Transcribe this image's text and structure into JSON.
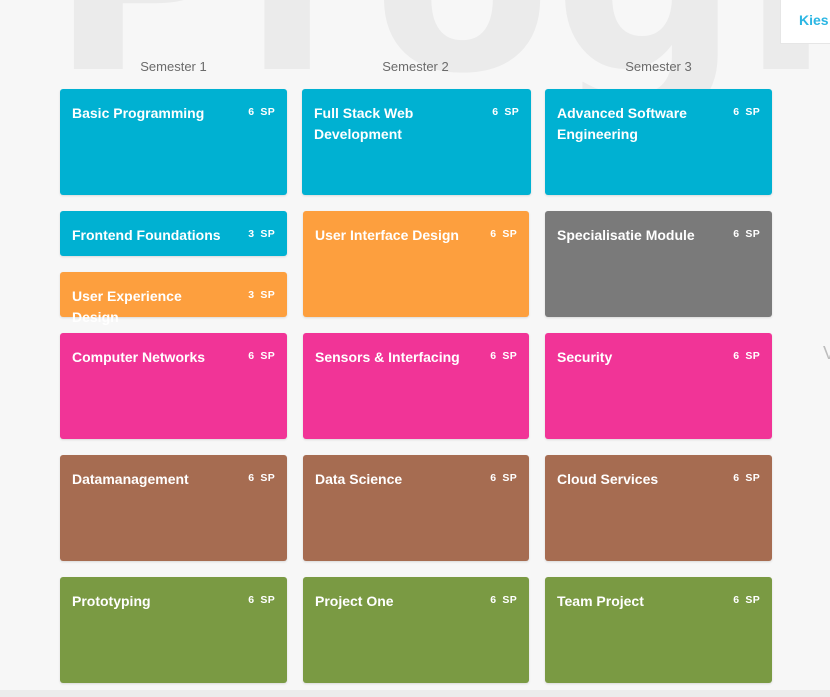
{
  "background_watermark": "Progra",
  "top_tab_label": "Kies",
  "edge_letter": "V",
  "semesters": [
    {
      "label": "Semester 1"
    },
    {
      "label": "Semester 2"
    },
    {
      "label": "Semester 3"
    }
  ],
  "credit_unit": "SP",
  "colors": {
    "blue": "#00b1d2",
    "orange": "#fd9f3e",
    "gray": "#7a7a7a",
    "pink": "#f13497",
    "brown": "#a66c51",
    "green": "#7a9a43"
  },
  "modules": [
    {
      "title": "Basic Programming",
      "credits": "6",
      "color": "blue"
    },
    {
      "title": "Full Stack Web Development",
      "credits": "6",
      "color": "blue"
    },
    {
      "title": "Advanced Software Engineering",
      "credits": "6",
      "color": "blue"
    },
    {
      "title": "Frontend Foundations",
      "credits": "3",
      "color": "blue"
    },
    {
      "title": "User Experience Design",
      "credits": "3",
      "color": "orange"
    },
    {
      "title": "User Interface Design",
      "credits": "6",
      "color": "orange"
    },
    {
      "title": "Specialisatie Module",
      "credits": "6",
      "color": "gray"
    },
    {
      "title": "Computer Networks",
      "credits": "6",
      "color": "pink"
    },
    {
      "title": "Sensors & Interfacing",
      "credits": "6",
      "color": "pink"
    },
    {
      "title": "Security",
      "credits": "6",
      "color": "pink"
    },
    {
      "title": "Datamanagement",
      "credits": "6",
      "color": "brown"
    },
    {
      "title": "Data Science",
      "credits": "6",
      "color": "brown"
    },
    {
      "title": "Cloud Services",
      "credits": "6",
      "color": "brown"
    },
    {
      "title": "Prototyping",
      "credits": "6",
      "color": "green"
    },
    {
      "title": "Project One",
      "credits": "6",
      "color": "green"
    },
    {
      "title": "Team Project",
      "credits": "6",
      "color": "green"
    }
  ]
}
